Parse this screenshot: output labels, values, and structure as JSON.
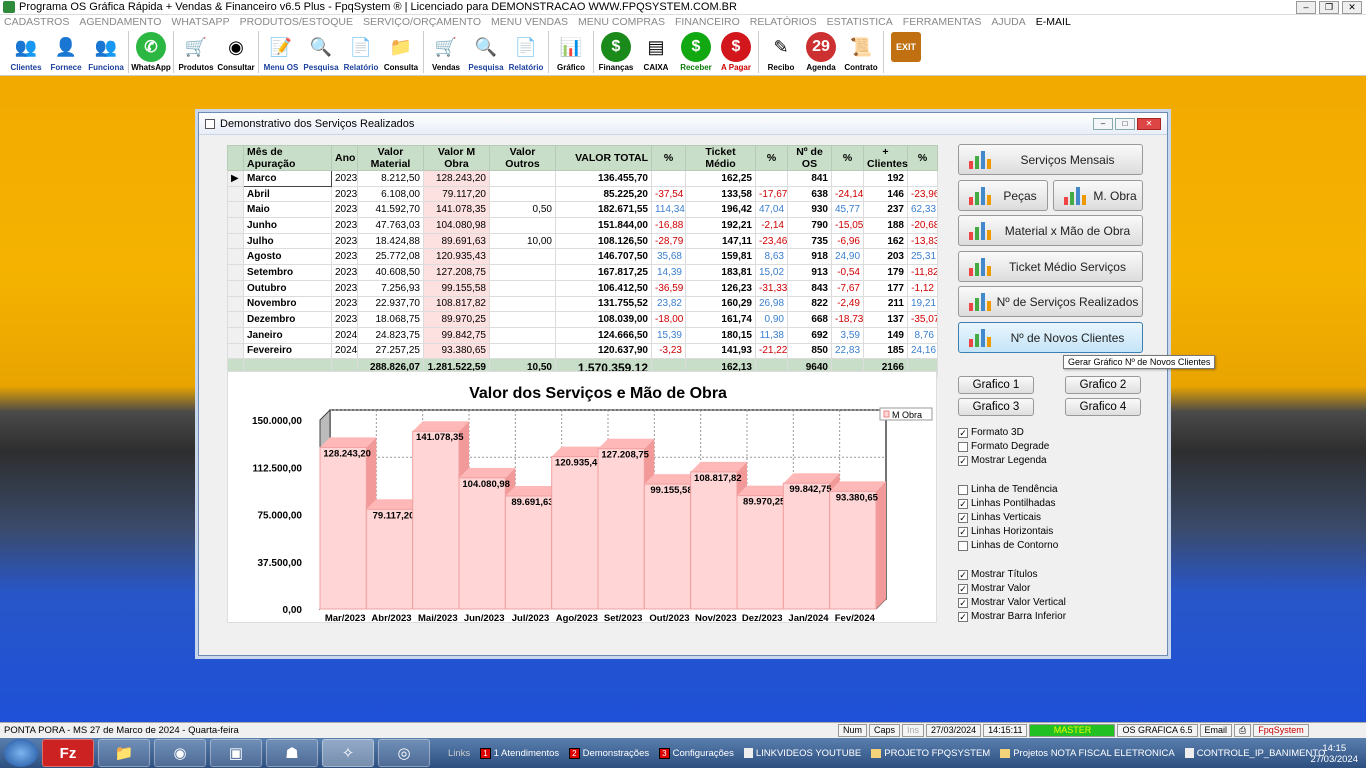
{
  "window": {
    "title": "Programa OS Gráfica Rápida + Vendas & Financeiro v6.5 Plus - FpqSystem ® | Licenciado para  DEMONSTRACAO WWW.FPQSYSTEM.COM.BR"
  },
  "menu": [
    "CADASTROS",
    "AGENDAMENTO",
    "WHATSAPP",
    "PRODUTOS/ESTOQUE",
    "SERVIÇO/ORÇAMENTO",
    "MENU VENDAS",
    "MENU COMPRAS",
    "FINANCEIRO",
    "RELATÓRIOS",
    "ESTATISTICA",
    "FERRAMENTAS",
    "AJUDA",
    "E-MAIL"
  ],
  "toolbar": [
    {
      "label": "Clientes",
      "icon": "clients-icon",
      "glyph": "👥"
    },
    {
      "label": "Fornece",
      "icon": "supplier-icon",
      "glyph": "👤"
    },
    {
      "label": "Funciona",
      "icon": "employees-icon",
      "glyph": "👥"
    },
    {
      "label": "WhatsApp",
      "icon": "whatsapp-icon",
      "glyph": "✆"
    },
    {
      "label": "Produtos",
      "icon": "products-icon",
      "glyph": "🛒"
    },
    {
      "label": "Consultar",
      "icon": "consult-icon",
      "glyph": "◉"
    },
    {
      "label": "Menu OS",
      "icon": "os-menu-icon",
      "glyph": "📝"
    },
    {
      "label": "Pesquisa",
      "icon": "search-os-icon",
      "glyph": "🔍"
    },
    {
      "label": "Relatório",
      "icon": "report-os-icon",
      "glyph": "📄"
    },
    {
      "label": "Consulta",
      "icon": "folder-icon",
      "glyph": "📁"
    },
    {
      "label": "Vendas",
      "icon": "sales-cart-icon",
      "glyph": "🛒"
    },
    {
      "label": "Pesquisa",
      "icon": "search-sales-icon",
      "glyph": "🔍"
    },
    {
      "label": "Relatório",
      "icon": "report-sales-icon",
      "glyph": "📄"
    },
    {
      "label": "Gráfico",
      "icon": "chart-icon",
      "glyph": "📊"
    },
    {
      "label": "Finanças",
      "icon": "finance-icon",
      "glyph": "$"
    },
    {
      "label": "CAIXA",
      "icon": "cash-icon",
      "glyph": "▤"
    },
    {
      "label": "Receber",
      "icon": "receive-icon",
      "glyph": "$"
    },
    {
      "label": "A Pagar",
      "icon": "pay-icon",
      "glyph": "$"
    },
    {
      "label": "Recibo",
      "icon": "receipt-icon",
      "glyph": "✎"
    },
    {
      "label": "Agenda",
      "icon": "calendar-icon",
      "glyph": "29"
    },
    {
      "label": "Contrato",
      "icon": "contract-icon",
      "glyph": "📜"
    },
    {
      "label": "",
      "icon": "exit-icon",
      "glyph": "EXIT"
    }
  ],
  "dialog": {
    "title": "Demonstrativo dos Serviços Realizados"
  },
  "table": {
    "headers": [
      "Mês de Apuração",
      "Ano",
      "Valor Material",
      "Valor M Obra",
      "Valor Outros",
      "VALOR TOTAL",
      "%",
      "Ticket Médio",
      "%",
      "Nº de OS",
      "%",
      "+ Clientes",
      "%"
    ],
    "rows": [
      [
        "Marco",
        "2023",
        "8.212,50",
        "128.243,20",
        "",
        "136.455,70",
        "",
        "162,25",
        "",
        "841",
        "",
        "192",
        ""
      ],
      [
        "Abril",
        "2023",
        "6.108,00",
        "79.117,20",
        "",
        "85.225,20",
        "-37,54",
        "133,58",
        "-17,67",
        "638",
        "-24,14",
        "146",
        "-23,96"
      ],
      [
        "Maio",
        "2023",
        "41.592,70",
        "141.078,35",
        "0,50",
        "182.671,55",
        "114,34",
        "196,42",
        "47,04",
        "930",
        "45,77",
        "237",
        "62,33"
      ],
      [
        "Junho",
        "2023",
        "47.763,03",
        "104.080,98",
        "",
        "151.844,00",
        "-16,88",
        "192,21",
        "-2,14",
        "790",
        "-15,05",
        "188",
        "-20,68"
      ],
      [
        "Julho",
        "2023",
        "18.424,88",
        "89.691,63",
        "10,00",
        "108.126,50",
        "-28,79",
        "147,11",
        "-23,46",
        "735",
        "-6,96",
        "162",
        "-13,83"
      ],
      [
        "Agosto",
        "2023",
        "25.772,08",
        "120.935,43",
        "",
        "146.707,50",
        "35,68",
        "159,81",
        "8,63",
        "918",
        "24,90",
        "203",
        "25,31"
      ],
      [
        "Setembro",
        "2023",
        "40.608,50",
        "127.208,75",
        "",
        "167.817,25",
        "14,39",
        "183,81",
        "15,02",
        "913",
        "-0,54",
        "179",
        "-11,82"
      ],
      [
        "Outubro",
        "2023",
        "7.256,93",
        "99.155,58",
        "",
        "106.412,50",
        "-36,59",
        "126,23",
        "-31,33",
        "843",
        "-7,67",
        "177",
        "-1,12"
      ],
      [
        "Novembro",
        "2023",
        "22.937,70",
        "108.817,82",
        "",
        "131.755,52",
        "23,82",
        "160,29",
        "26,98",
        "822",
        "-2,49",
        "211",
        "19,21"
      ],
      [
        "Dezembro",
        "2023",
        "18.068,75",
        "89.970,25",
        "",
        "108.039,00",
        "-18,00",
        "161,74",
        "0,90",
        "668",
        "-18,73",
        "137",
        "-35,07"
      ],
      [
        "Janeiro",
        "2024",
        "24.823,75",
        "99.842,75",
        "",
        "124.666,50",
        "15,39",
        "180,15",
        "11,38",
        "692",
        "3,59",
        "149",
        "8,76"
      ],
      [
        "Fevereiro",
        "2024",
        "27.257,25",
        "93.380,65",
        "",
        "120.637,90",
        "-3,23",
        "141,93",
        "-21,22",
        "850",
        "22,83",
        "185",
        "24,16"
      ]
    ],
    "totals": [
      "",
      "",
      "288.826,07",
      "1.281.522,59",
      "10,50",
      "1.570.359,12",
      "",
      "162,13",
      "",
      "9640",
      "",
      "2166",
      ""
    ]
  },
  "chart_data": {
    "type": "bar",
    "title": "Valor dos Serviços e Mão de Obra",
    "categories": [
      "Mar/2023",
      "Abr/2023",
      "Mai/2023",
      "Jun/2023",
      "Jul/2023",
      "Ago/2023",
      "Set/2023",
      "Out/2023",
      "Nov/2023",
      "Dez/2023",
      "Jan/2024",
      "Fev/2024"
    ],
    "series": [
      {
        "name": "M Obra",
        "values": [
          128243.2,
          79117.2,
          141078.35,
          104080.98,
          89691.63,
          120935.43,
          127208.75,
          99155.58,
          108817.82,
          89970.25,
          99842.75,
          93380.65
        ]
      }
    ],
    "value_labels": [
      "128.243,20",
      "79.117,20",
      "141.078,35",
      "104.080,98",
      "89.691,63",
      "120.935,43",
      "127.208,75",
      "99.155,58",
      "108.817,82",
      "89.970,25",
      "99.842,75",
      "93.380,65"
    ],
    "y_ticks": [
      "0,00",
      "37.500,00",
      "75.000,00",
      "112.500,00",
      "150.000,00"
    ],
    "ylim": [
      0,
      150000
    ],
    "bar_color": "#ffd5d5",
    "legend": "top-right",
    "grid": true,
    "style": "3d"
  },
  "buttons": {
    "servicos_mensais": "Serviços Mensais",
    "pecas": "Peças",
    "m_obra": "M. Obra",
    "material_mao": "Material x Mão de Obra",
    "ticket_medio": "Ticket Médio Serviços",
    "n_servicos": "Nº de Serviços Realizados",
    "n_clientes": "Nº de Novos Clientes",
    "grafico1": "Grafico 1",
    "grafico2": "Grafico 2",
    "grafico3": "Grafico 3",
    "grafico4": "Grafico 4"
  },
  "tooltip": "Gerar Gráfico Nº de Novos Clientes",
  "options": [
    {
      "label": "Formato 3D",
      "checked": true
    },
    {
      "label": "Formato Degrade",
      "checked": false
    },
    {
      "label": "Mostrar Legenda",
      "checked": true
    },
    {
      "label": "Linha de Tendência",
      "checked": false
    },
    {
      "label": "Linhas Pontilhadas",
      "checked": true
    },
    {
      "label": "Linhas Verticais",
      "checked": true
    },
    {
      "label": "Linhas Horizontais",
      "checked": true
    },
    {
      "label": "Linhas de Contorno",
      "checked": false
    },
    {
      "label": "Mostrar Títulos",
      "checked": true
    },
    {
      "label": "Mostrar Valor",
      "checked": true
    },
    {
      "label": "Mostrar Valor Vertical",
      "checked": true
    },
    {
      "label": "Mostrar Barra Inferior",
      "checked": true
    }
  ],
  "status": {
    "location": "PONTA PORA - MS 27 de Marco de 2024 - Quarta-feira",
    "num": "Num",
    "caps": "Caps",
    "ins": "Ins",
    "date": "27/03/2024",
    "time": "14:15:11",
    "master": "MASTER",
    "os": "OS GRAFICA 6.5",
    "email": "Email",
    "brand": "FpqSystem"
  },
  "taskbar": {
    "links_label": "Links",
    "links": [
      {
        "n": "1",
        "text": "1 Atendimentos",
        "kind": "num"
      },
      {
        "n": "2",
        "text": "Demonstrações",
        "kind": "num"
      },
      {
        "n": "3",
        "text": "Configurações",
        "kind": "num"
      },
      {
        "n": "",
        "text": "LINKVIDEOS YOUTUBE",
        "kind": "web"
      },
      {
        "n": "",
        "text": "PROJETO FPQSYSTEM",
        "kind": "folder"
      },
      {
        "n": "",
        "text": "Projetos NOTA FISCAL ELETRONICA",
        "kind": "folder"
      },
      {
        "n": "",
        "text": "CONTROLE_IP_BANIMENTO",
        "kind": "web"
      }
    ],
    "clock_time": "14:15",
    "clock_date": "27/03/2024"
  }
}
